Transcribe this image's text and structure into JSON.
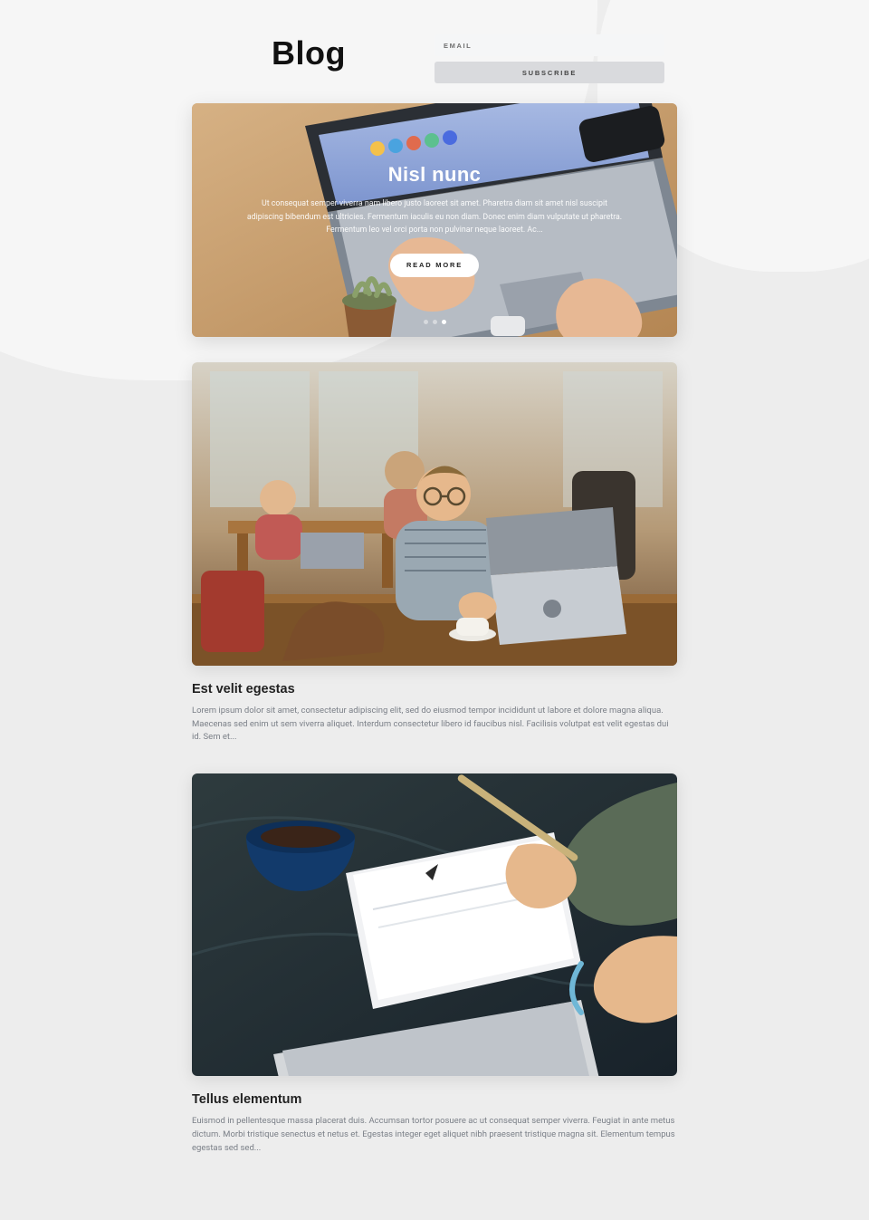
{
  "header": {
    "title": "Blog",
    "email_placeholder": "EMAIL",
    "subscribe_label": "SUBSCRIBE"
  },
  "hero": {
    "title": "Nisl nunc",
    "excerpt": "Ut consequat semper viverra nam libero justo laoreet sit amet. Pharetra diam sit amet nisl suscipit adipiscing bibendum est ultricies. Fermentum iaculis eu non diam. Donec enim diam vulputate ut pharetra. Fermentum leo vel orci porta non pulvinar neque laoreet. Ac...",
    "read_more_label": "READ MORE",
    "active_dot_index": 2,
    "dot_count": 3
  },
  "posts": [
    {
      "title": "Est velit egestas",
      "excerpt": "Lorem ipsum dolor sit amet, consectetur adipiscing elit, sed do eiusmod tempor incididunt ut labore et dolore magna aliqua. Maecenas sed enim ut sem viverra aliquet. Interdum consectetur libero id faucibus nisl. Facilisis volutpat est velit egestas dui id. Sem et..."
    },
    {
      "title": "Tellus elementum",
      "excerpt": "Euismod in pellentesque massa placerat duis. Accumsan tortor posuere ac ut consequat semper viverra. Feugiat in ante metus dictum. Morbi tristique senectus et netus et. Egestas integer eget aliquet nibh praesent tristique magna sit. Elementum tempus egestas sed sed..."
    }
  ]
}
